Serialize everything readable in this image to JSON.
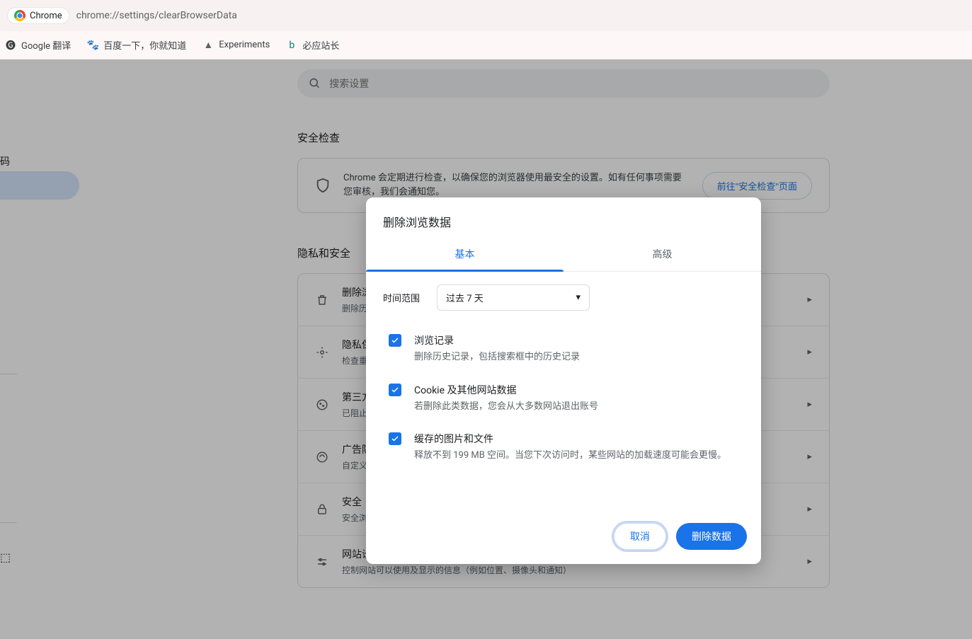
{
  "address": {
    "chip": "Chrome",
    "url": "chrome://settings/clearBrowserData"
  },
  "bookmarks": [
    {
      "label": "Google 翻译",
      "icon": "google"
    },
    {
      "label": "百度一下，你就知道",
      "icon": "baidu"
    },
    {
      "label": "Experiments",
      "icon": "experiments"
    },
    {
      "label": "必应站长",
      "icon": "bing"
    }
  ],
  "left_peek": {
    "item0": "码",
    "open": "⬚"
  },
  "search": {
    "placeholder": "搜索设置"
  },
  "sections": {
    "safety_title": "安全检查",
    "safety_text": "Chrome 会定期进行检查，以确保您的浏览器使用最安全的设置。如有任何事项需要您审核，我们会通知您。",
    "safety_btn": "前往\"安全检查\"页面",
    "privacy_title": "隐私和安全"
  },
  "rows": [
    {
      "icon": "trash",
      "t1": "删除浏览数据",
      "t2": "删除历史记录、Cookie、缓存内容及其他数据"
    },
    {
      "icon": "privacy",
      "t1": "隐私保护指南",
      "t2": "检查重要的隐私和安全控制项"
    },
    {
      "icon": "cookie",
      "t1": "第三方 Cookie",
      "t2": "已阻止无痕模式下第三方 Cookie"
    },
    {
      "icon": "ads",
      "t1": "广告隐私权",
      "t2": "自定义网站用来向您投放广告的信息"
    },
    {
      "icon": "lock",
      "t1": "安全",
      "t2": "安全浏览（免受危险网站危害）和其他安全设置"
    },
    {
      "icon": "sliders",
      "t1": "网站设置",
      "t2": "控制网站可以使用及显示的信息（例如位置、摄像头和通知）"
    }
  ],
  "dialog": {
    "title": "删除浏览数据",
    "tabs": {
      "basic": "基本",
      "advanced": "高级"
    },
    "range_label": "时间范围",
    "range_value": "过去 7 天",
    "options": [
      {
        "t1": "浏览记录",
        "t2": "删除历史记录，包括搜索框中的历史记录"
      },
      {
        "t1": "Cookie 及其他网站数据",
        "t2": "若删除此类数据，您会从大多数网站退出账号"
      },
      {
        "t1": "缓存的图片和文件",
        "t2": "释放不到 199 MB 空间。当您下次访问时，某些网站的加载速度可能会更慢。"
      }
    ],
    "cancel": "取消",
    "confirm": "删除数据"
  }
}
